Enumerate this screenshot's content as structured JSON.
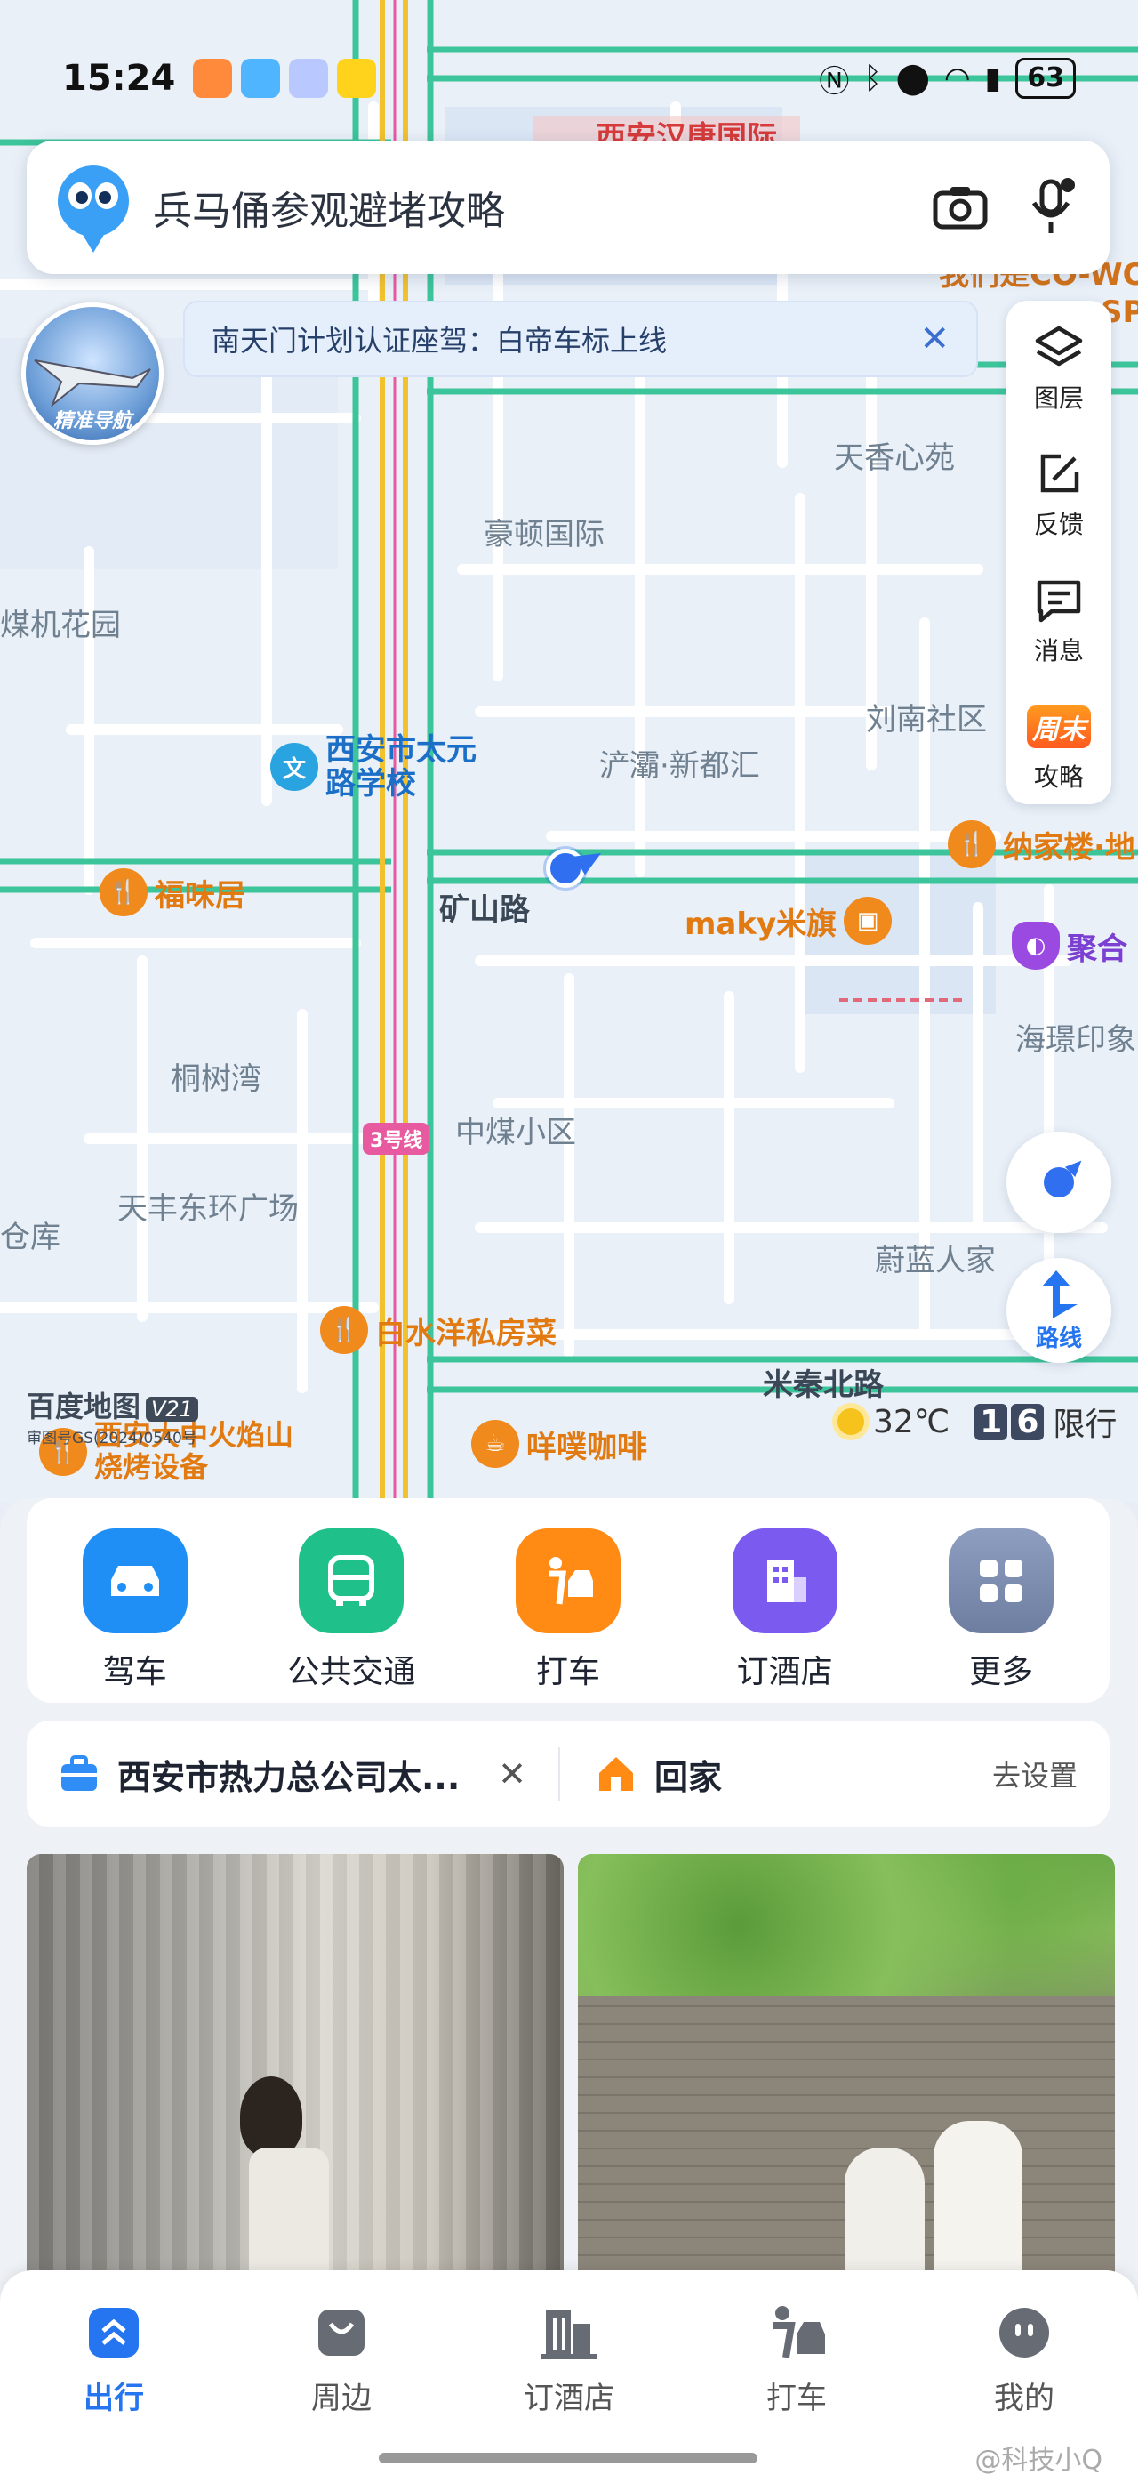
{
  "status_bar": {
    "time": "15:24",
    "battery": "63"
  },
  "search": {
    "query": "兵马俑参观避堵攻略"
  },
  "notice": {
    "text": "南天门计划认证座驾：白帝车标上线"
  },
  "nav_badge": {
    "label": "精准导航"
  },
  "side_tools": [
    {
      "label": "图层",
      "icon": "layers-icon"
    },
    {
      "label": "反馈",
      "icon": "edit-icon"
    },
    {
      "label": "消息",
      "icon": "message-icon"
    },
    {
      "label": "攻略",
      "icon": "weekend-guide-icon",
      "badge": "周末"
    }
  ],
  "route_button": {
    "label": "路线"
  },
  "map": {
    "area_labels": {
      "a": "天香心苑",
      "b": "豪顿国际",
      "c": "煤机花园",
      "d": "刘南社区",
      "e": "浐灞·新都汇",
      "f": "矿山路",
      "g": "海璟印象",
      "h": "桐树湾",
      "i": "中煤小区",
      "j": "天丰东环广场",
      "k": "仓库",
      "l": "蔚蓝人家",
      "m": "米秦北路",
      "n": "3号线",
      "o": "西安汉唐国际",
      "p": "我们是CO-WO",
      "q": "SP"
    },
    "pois": {
      "school": "西安市太元\n路学校",
      "fuweiju": "福味居",
      "najialou": "纳家楼·地",
      "maky": "maky米旗",
      "juhe": "聚合",
      "baishuiyang": "白水洋私房菜",
      "huoyanshan": "西安大中火焰山\n烧烤设备",
      "coffee": "咩噗咖啡"
    }
  },
  "brand": {
    "name": "百度地图",
    "version": "V21",
    "approval": "审图号GS(2024)0540号"
  },
  "weather": {
    "temperature": "32℃",
    "plate_digits": [
      "1",
      "6"
    ],
    "restriction": "限行"
  },
  "quick_actions": [
    {
      "label": "驾车",
      "icon": "car-icon",
      "color": "#1f8ff5"
    },
    {
      "label": "公共交通",
      "icon": "bus-icon",
      "color": "#1fc08a"
    },
    {
      "label": "打车",
      "icon": "taxi-icon",
      "color": "#ff8a14"
    },
    {
      "label": "订酒店",
      "icon": "hotel-icon",
      "color": "#7b5af0"
    },
    {
      "label": "更多",
      "icon": "grid-icon",
      "color": "#7a8aa6"
    }
  ],
  "places": {
    "recent": "西安市热力总公司太...",
    "home_label": "回家",
    "home_action": "去设置"
  },
  "tabs": [
    {
      "label": "出行",
      "icon": "travel-icon",
      "active": true
    },
    {
      "label": "周边",
      "icon": "nearby-icon",
      "active": false
    },
    {
      "label": "订酒店",
      "icon": "hotel-tab-icon",
      "active": false
    },
    {
      "label": "打车",
      "icon": "taxi-tab-icon",
      "active": false
    },
    {
      "label": "我的",
      "icon": "profile-icon",
      "active": false
    }
  ],
  "credit": "@科技小Q"
}
